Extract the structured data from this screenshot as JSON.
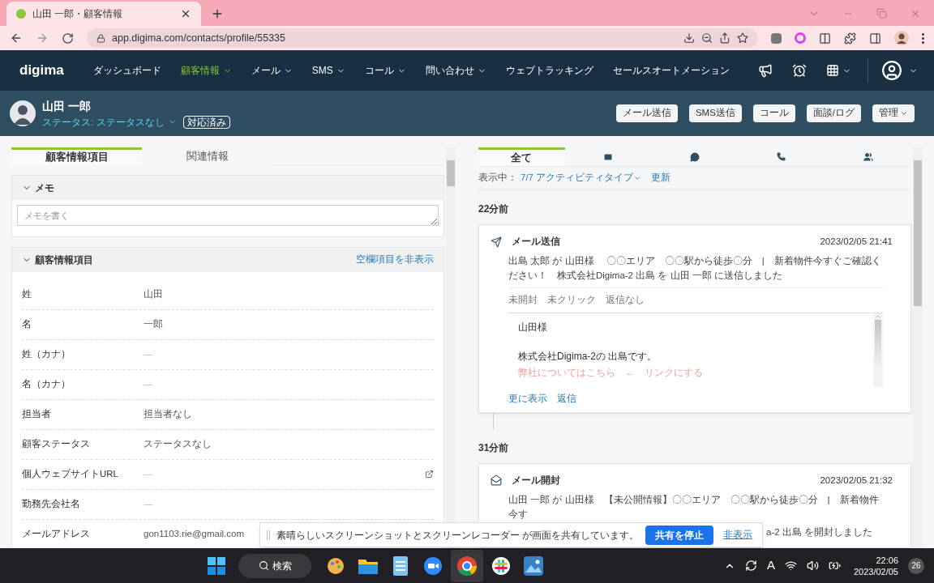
{
  "browser": {
    "tab_title": "山田 一郎・顧客情報",
    "url": "app.digima.com/contacts/profile/55335"
  },
  "nav": {
    "logo": "digima",
    "items": [
      {
        "label": "ダッシュボード",
        "selected": false,
        "dropdown": false
      },
      {
        "label": "顧客情報",
        "selected": true,
        "dropdown": true
      },
      {
        "label": "メール",
        "selected": false,
        "dropdown": true
      },
      {
        "label": "SMS",
        "selected": false,
        "dropdown": true
      },
      {
        "label": "コール",
        "selected": false,
        "dropdown": true
      },
      {
        "label": "問い合わせ",
        "selected": false,
        "dropdown": true
      },
      {
        "label": "ウェブトラッキング",
        "selected": false,
        "dropdown": false
      },
      {
        "label": "セールスオートメーション",
        "selected": false,
        "dropdown": false
      }
    ]
  },
  "contact": {
    "name": "山田 一郎",
    "status": "ステータス: ステータスなし",
    "badge": "対応済み",
    "buttons": [
      {
        "label": "メール送信",
        "dropdown": false
      },
      {
        "label": "SMS送信",
        "dropdown": false
      },
      {
        "label": "コール",
        "dropdown": false
      },
      {
        "label": "面談/ログ",
        "dropdown": false
      },
      {
        "label": "管理",
        "dropdown": true
      }
    ]
  },
  "left": {
    "tabs": [
      {
        "label": "顧客情報項目",
        "selected": true
      },
      {
        "label": "関連情報",
        "selected": false
      }
    ],
    "memo": {
      "title": "メモ",
      "expanded": true,
      "placeholder": "メモを書く"
    },
    "info": {
      "title": "顧客情報項目",
      "expanded": true,
      "hide_link": "空欄項目を非表示",
      "fields": [
        {
          "label": "姓",
          "value": "山田",
          "kind": "text"
        },
        {
          "label": "名",
          "value": "一郎",
          "kind": "text"
        },
        {
          "label": "姓（カナ）",
          "value": "—",
          "kind": "text"
        },
        {
          "label": "名（カナ）",
          "value": "—",
          "kind": "text"
        },
        {
          "label": "担当者",
          "value": "担当者なし",
          "kind": "text"
        },
        {
          "label": "顧客ステータス",
          "value": "ステータスなし",
          "kind": "text"
        },
        {
          "label": "個人ウェブサイトURL",
          "value": "—",
          "kind": "url"
        },
        {
          "label": "勤務先会社名",
          "value": "—",
          "kind": "text"
        },
        {
          "label": "メールアドレス",
          "value": "gon1103.rie@gmail.com",
          "kind": "text"
        }
      ]
    }
  },
  "right": {
    "tabs": [
      {
        "kind": "all",
        "label": "全て",
        "selected": true
      },
      {
        "kind": "mail",
        "selected": false
      },
      {
        "kind": "chat",
        "selected": false
      },
      {
        "kind": "phone",
        "selected": false
      },
      {
        "kind": "group",
        "selected": false
      }
    ],
    "filter": {
      "prefix": "表示中：",
      "link": "7/7 アクティビティタイプ",
      "refresh": "更新"
    },
    "groups": [
      {
        "time": "22分前",
        "card": {
          "kind": "sent",
          "title": "メール送信",
          "datetime": "2023/02/05 21:41",
          "summary": [
            {
              "text": "出島 太郎 が 山田様　 〇〇エリア　〇〇駅から徒歩〇分　|　新着物件今すぐご確認ください！　株式会社Digima-2 出島 を 山田 一郎 に送信しました",
              "kind": "full"
            }
          ],
          "tracking": [
            "未開封",
            "未クリック",
            "返信なし"
          ],
          "body": [
            {
              "text": "山田様",
              "kind": "greeting"
            },
            {
              "text": "株式会社Digima-2の 出島です。",
              "kind": "plain"
            },
            {
              "text": "弊社についてはこちら　←　リンクにする",
              "kind": "note"
            }
          ],
          "actions": [
            "更に表示",
            "返信"
          ]
        }
      },
      {
        "time": "31分前",
        "card": {
          "kind": "opened",
          "title": "メール開封",
          "datetime": "2023/02/05 21:32",
          "summary": [
            {
              "text": "山田 一郎 が 山田様　【未公開情報】〇〇エリア　〇〇駅から徒歩〇分　|　新着物件今す",
              "kind": "full"
            },
            {
              "text": "a-2 出島 を開封しました",
              "kind": "covered"
            }
          ]
        }
      }
    ]
  },
  "share_bar": {
    "message": "素晴らしいスクリーンショットとスクリーンレコーダー が画面を共有しています。",
    "stop": "共有を停止",
    "hide": "非表示"
  },
  "taskbar": {
    "search": "検索",
    "tray_letter": "A",
    "time": "22:06",
    "date": "2023/02/05",
    "badge": "26"
  }
}
